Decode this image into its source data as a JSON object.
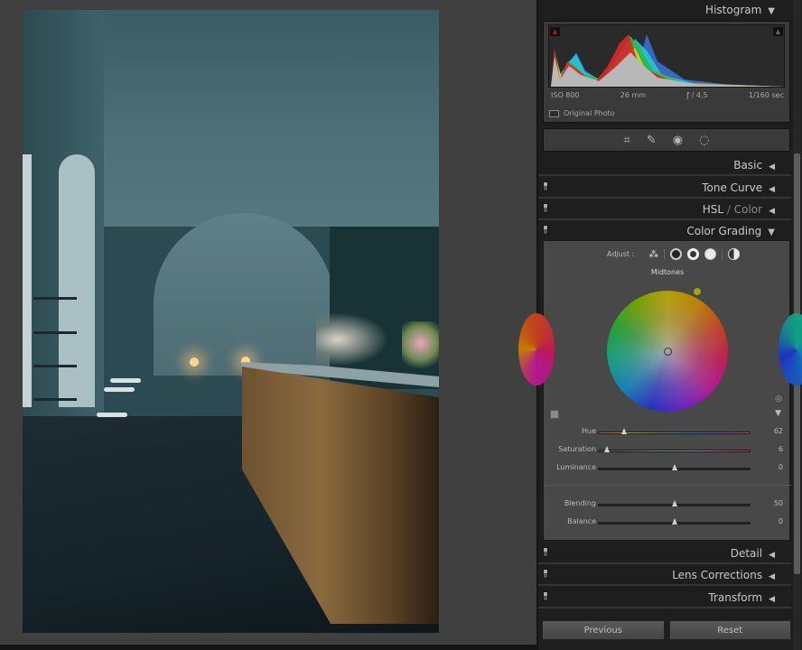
{
  "histogram": {
    "title": "Histogram",
    "exif": {
      "iso": "ISO 800",
      "focal": "26 mm",
      "aperture": "ƒ / 4,5",
      "shutter": "1/160 sec"
    },
    "original_photo_label": "Original Photo",
    "shadow_clip_color": "#cc1111",
    "highlight_clip_color": "#555555"
  },
  "tools": [
    "crop-icon",
    "healing-icon",
    "red-eye-icon",
    "masking-icon"
  ],
  "sections": {
    "basic": "Basic",
    "tone_curve": "Tone Curve",
    "hsl": "HSL",
    "hsl_sep": " / ",
    "color": "Color",
    "color_grading": "Color Grading",
    "detail": "Detail",
    "lens_corrections": "Lens Corrections",
    "transform": "Transform"
  },
  "color_grading": {
    "adjust_label": "Adjust :",
    "active_mode": "Midtones",
    "wheel_label": "Midtones",
    "handle_color": "#a8a400",
    "sliders": [
      {
        "label": "Hue",
        "value": "62",
        "pct": 0.17
      },
      {
        "label": "Saturation",
        "value": "6",
        "pct": 0.06
      },
      {
        "label": "Luminance",
        "value": "0",
        "pct": 0.5
      },
      {
        "label": "Blending",
        "value": "50",
        "pct": 0.5
      },
      {
        "label": "Balance",
        "value": "0",
        "pct": 0.5
      }
    ]
  },
  "buttons": {
    "previous": "Previous",
    "reset": "Reset"
  }
}
